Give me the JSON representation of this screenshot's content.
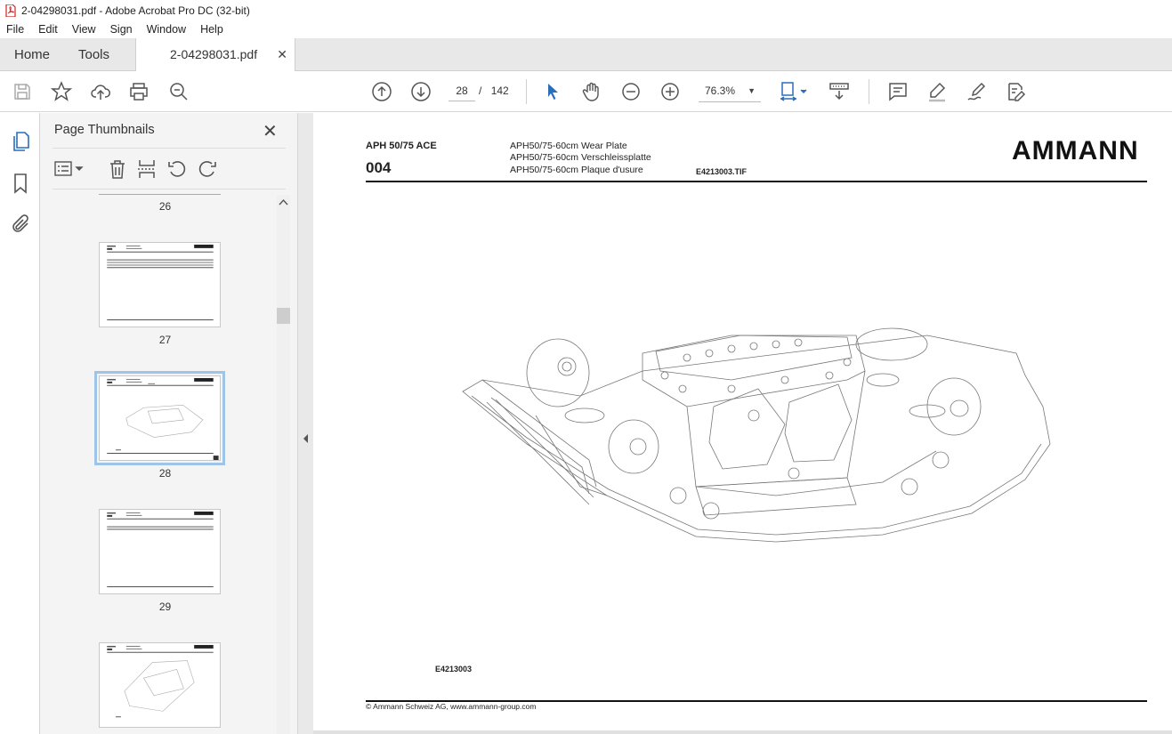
{
  "window": {
    "title": "2-04298031.pdf - Adobe Acrobat Pro DC (32-bit)"
  },
  "menu": [
    "File",
    "Edit",
    "View",
    "Sign",
    "Window",
    "Help"
  ],
  "tabs": {
    "home": "Home",
    "tools": "Tools",
    "document": "2-04298031.pdf"
  },
  "toolbar": {
    "current_page": "28",
    "page_separator": "/",
    "total_pages": "142",
    "zoom": "76.3%"
  },
  "thumbnail_panel": {
    "title": "Page Thumbnails",
    "page_numbers": [
      "26",
      "27",
      "28",
      "29"
    ],
    "selected_page": "28"
  },
  "document_page": {
    "model": "APH 50/75 ACE",
    "group_number": "004",
    "description_en": "APH50/75-60cm Wear Plate",
    "description_de": "APH50/75-60cm Verschleissplatte",
    "description_fr": "APH50/75-60cm Plaque d'usure",
    "image_file": "E4213003.TIF",
    "brand_logo": "AMMANN",
    "drawing_caption": "E4213003",
    "copyright": "© Ammann Schweiz AG, www.ammann-group.com"
  },
  "colors": {
    "accent_blue": "#2a6ebb",
    "selection": "#9ec4e8"
  }
}
